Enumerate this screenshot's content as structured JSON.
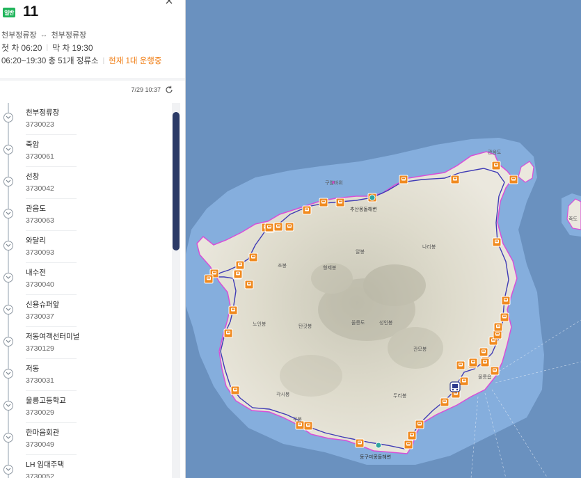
{
  "route": {
    "type_label": "일반",
    "number": "11",
    "close_icon": "close-icon",
    "origin": "천부정류장",
    "destination": "천부정류장",
    "first_label": "첫 차",
    "first_time": "06:20",
    "last_label": "막 차",
    "last_time": "19:30",
    "summary": "06:20~19:30 총 51개 정류소",
    "running": "현재 1대 운행중",
    "badge_color": "#1fb45a",
    "running_color": "#f07d13"
  },
  "update": {
    "time": "7/29 10:37",
    "refresh_icon": "refresh-icon"
  },
  "stops": [
    {
      "name": "천부정류장",
      "id": "3730023"
    },
    {
      "name": "죽암",
      "id": "3730061"
    },
    {
      "name": "선창",
      "id": "3730042"
    },
    {
      "name": "관음도",
      "id": "3730063"
    },
    {
      "name": "와달리",
      "id": "3730093"
    },
    {
      "name": "내수전",
      "id": "3730040"
    },
    {
      "name": "신용슈퍼앞",
      "id": "3730037"
    },
    {
      "name": "저동여객선터미널",
      "id": "3730129"
    },
    {
      "name": "저동",
      "id": "3730031"
    },
    {
      "name": "울릉고등학교",
      "id": "3730029"
    },
    {
      "name": "한마음회관",
      "id": "3730049"
    },
    {
      "name": "LH 임대주택",
      "id": "3730052"
    }
  ],
  "map": {
    "labels": [
      {
        "key": "gujimi",
        "text": "구암바위"
      },
      {
        "key": "chubeach",
        "text": "추산몽돌해변"
      },
      {
        "key": "albong",
        "text": "알봉"
      },
      {
        "key": "narabong",
        "text": "나리봉"
      },
      {
        "key": "chobong",
        "text": "초봉"
      },
      {
        "key": "hyeongjebong",
        "text": "형제봉"
      },
      {
        "key": "noinbong",
        "text": "노인봉"
      },
      {
        "key": "tangatbong",
        "text": "탄갓봉"
      },
      {
        "key": "ulleungdo",
        "text": "울릉도"
      },
      {
        "key": "seonginbong",
        "text": "성인봉"
      },
      {
        "key": "gwanmobong",
        "text": "관모봉"
      },
      {
        "key": "gaksibong",
        "text": "각시봉"
      },
      {
        "key": "durabong",
        "text": "두리봉"
      },
      {
        "key": "gubong",
        "text": "구봉"
      },
      {
        "key": "donggumi",
        "text": "동구미몽돌해변"
      },
      {
        "key": "jukdo",
        "text": "죽도"
      },
      {
        "key": "gwaneumdo",
        "text": "관음도"
      },
      {
        "key": "jeodong",
        "text": "울릉읍"
      }
    ],
    "colors": {
      "sea": "#6a91bf",
      "shallow": "#85aedd",
      "land": "#e9e6dc",
      "route": "#3f3bb5",
      "boundary": "#d84fd8",
      "stop_marker": "#f08a1f",
      "bus": "#2d3a8c"
    }
  }
}
